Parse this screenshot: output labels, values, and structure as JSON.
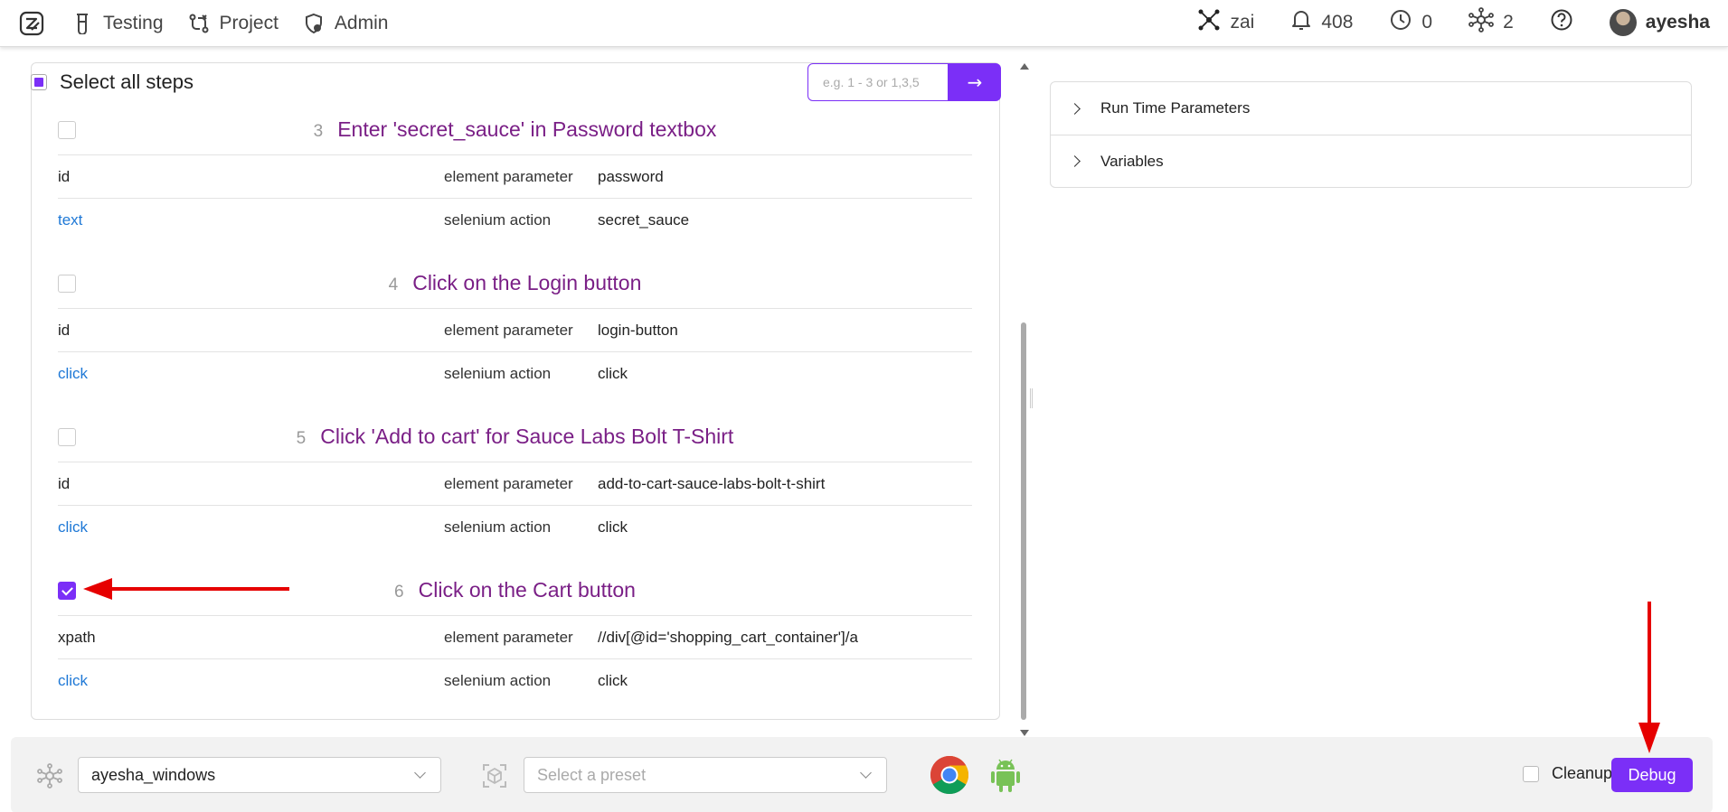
{
  "nav": {
    "items": [
      {
        "label": "Testing",
        "icon": "beaker-icon"
      },
      {
        "label": "Project",
        "icon": "project-icon"
      },
      {
        "label": "Admin",
        "icon": "shield-icon"
      }
    ],
    "right": {
      "agent_label": "zai",
      "notifications_count": "408",
      "history_count": "0",
      "nodes_count": "2",
      "username": "ayesha"
    }
  },
  "toolbar": {
    "select_all_label": "Select all steps",
    "range_placeholder": "e.g. 1 - 3 or 1,3,5",
    "go_label": "→"
  },
  "steps": [
    {
      "number": "3",
      "title": "Enter 'secret_sauce' in Password textbox",
      "checked": false,
      "rows": [
        {
          "key": "id",
          "type": "element parameter",
          "value": "password",
          "link": false
        },
        {
          "key": "text",
          "type": "selenium action",
          "value": "secret_sauce",
          "link": true
        }
      ]
    },
    {
      "number": "4",
      "title": "Click on the Login button",
      "checked": false,
      "rows": [
        {
          "key": "id",
          "type": "element parameter",
          "value": "login-button",
          "link": false
        },
        {
          "key": "click",
          "type": "selenium action",
          "value": "click",
          "link": true
        }
      ]
    },
    {
      "number": "5",
      "title": "Click 'Add to cart' for Sauce Labs Bolt T-Shirt",
      "checked": false,
      "rows": [
        {
          "key": "id",
          "type": "element parameter",
          "value": "add-to-cart-sauce-labs-bolt-t-shirt",
          "link": false
        },
        {
          "key": "click",
          "type": "selenium action",
          "value": "click",
          "link": true
        }
      ]
    },
    {
      "number": "6",
      "title": "Click on the Cart button",
      "checked": true,
      "rows": [
        {
          "key": "xpath",
          "type": "element parameter",
          "value": "//div[@id='shopping_cart_container']/a",
          "link": false
        },
        {
          "key": "click",
          "type": "selenium action",
          "value": "click",
          "link": true
        }
      ]
    }
  ],
  "right_panel": {
    "sections": [
      "Run Time Parameters",
      "Variables"
    ]
  },
  "bottom": {
    "node_value": "ayesha_windows",
    "preset_placeholder": "Select a preset",
    "browsers": [
      "chrome-icon",
      "android-icon"
    ],
    "cleanup_label": "Cleanup",
    "debug_label": "Debug"
  },
  "colors": {
    "accent": "#7b2ff7",
    "step_title": "#7a1f86",
    "link": "#1e78d6",
    "annotation": "#e60000"
  }
}
